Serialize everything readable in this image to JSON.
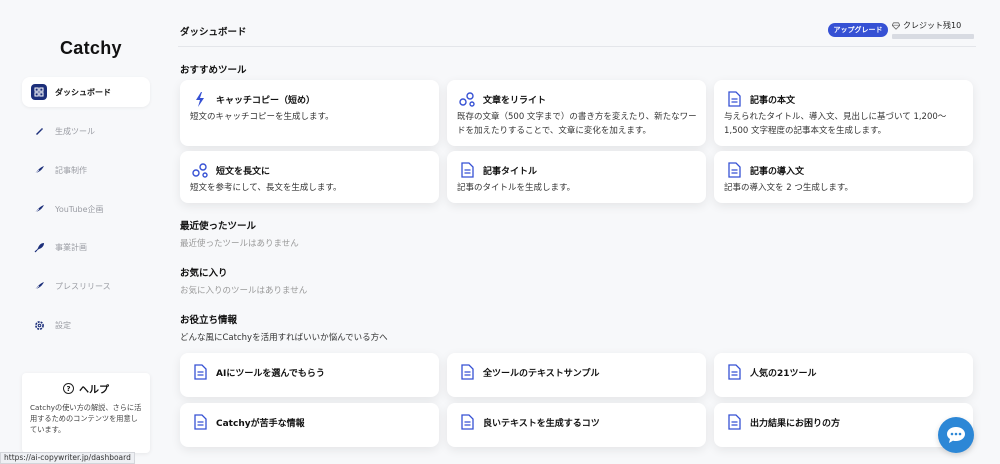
{
  "app": {
    "logo": "Catchy"
  },
  "sidebar": {
    "items": [
      {
        "label": "ダッシュボード",
        "icon": "dashboard-icon",
        "active": true
      },
      {
        "label": "生成ツール",
        "icon": "pen-icon",
        "active": false
      },
      {
        "label": "記事制作",
        "icon": "feather-icon",
        "active": false
      },
      {
        "label": "YouTube企画",
        "icon": "feather-icon",
        "active": false
      },
      {
        "label": "事業計画",
        "icon": "rocket-icon",
        "active": false
      },
      {
        "label": "プレスリリース",
        "icon": "feather-icon",
        "active": false
      },
      {
        "label": "設定",
        "icon": "gear-icon",
        "active": false
      }
    ]
  },
  "help": {
    "title": "ヘルプ",
    "desc": "Catchyの使い方の解説、さらに活用するためのコンテンツを用意しています。"
  },
  "status_url": "https://ai-copywriter.jp/dashboard",
  "header": {
    "title": "ダッシュボード",
    "upgrade_label": "アップグレード",
    "credit_label": "クレジット残10"
  },
  "recommended": {
    "title": "おすすめツール",
    "cards": [
      {
        "title": "キャッチコピー（短め）",
        "desc": "短文のキャッチコピーを生成します。",
        "icon": "bolt-icon"
      },
      {
        "title": "文章をリライト",
        "desc": "既存の文章（500 文字まで）の書き方を変えたり、新たなワードを加えたりすることで、文章に変化を加えます。",
        "icon": "nodes-icon"
      },
      {
        "title": "記事の本文",
        "desc": "与えられたタイトル、導入文、見出しに基づいて 1,200〜1,500 文字程度の記事本文を生成します。",
        "icon": "document-icon"
      },
      {
        "title": "短文を長文に",
        "desc": "短文を参考にして、長文を生成します。",
        "icon": "nodes-icon"
      },
      {
        "title": "記事タイトル",
        "desc": "記事のタイトルを生成します。",
        "icon": "document-icon"
      },
      {
        "title": "記事の導入文",
        "desc": "記事の導入文を 2 つ生成します。",
        "icon": "document-icon"
      }
    ]
  },
  "recent": {
    "title": "最近使ったツール",
    "empty": "最近使ったツールはありません"
  },
  "favorites": {
    "title": "お気に入り",
    "empty": "お気に入りのツールはありません"
  },
  "info": {
    "title": "お役立ち情報",
    "desc": "どんな風にCatchyを活用すればいいか悩んでいる方へ",
    "cards": [
      {
        "title": "AIにツールを選んでもらう",
        "icon": "document-icon"
      },
      {
        "title": "全ツールのテキストサンプル",
        "icon": "document-icon"
      },
      {
        "title": "人気の21ツール",
        "icon": "document-icon"
      },
      {
        "title": "Catchyが苦手な情報",
        "icon": "document-icon"
      },
      {
        "title": "良いテキストを生成するコツ",
        "icon": "document-icon"
      },
      {
        "title": "出力結果にお困りの方",
        "icon": "document-icon"
      }
    ]
  },
  "colors": {
    "accent": "#3651d4",
    "navy": "#1c2f7a",
    "chat": "#2c87d6"
  }
}
